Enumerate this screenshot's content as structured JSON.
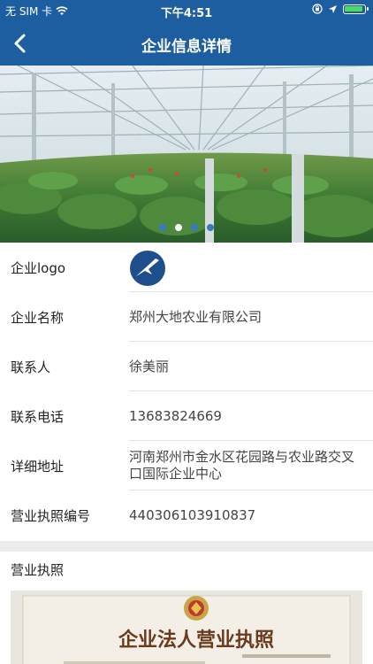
{
  "status_bar": {
    "carrier": "无 SIM 卡",
    "time": "下午4:51"
  },
  "nav": {
    "title": "企业信息详情"
  },
  "banner": {
    "slide_count": 4,
    "active_index": 1
  },
  "company": {
    "logo_label": "企业logo",
    "name_label": "企业名称",
    "name": "郑州大地农业有限公司",
    "contact_label": "联系人",
    "contact": "徐美丽",
    "phone_label": "联系电话",
    "phone": "13683824669",
    "address_label": "详细地址",
    "address": "河南郑州市金水区花园路与农业路交叉口国际企业中心",
    "license_no_label": "营业执照编号",
    "license_no": "440306103910837"
  },
  "license": {
    "title": "营业执照",
    "cert_title": "企业法人营业执照"
  },
  "colors": {
    "brand": "#1d5ea0",
    "logo": "#1e4f8c"
  }
}
